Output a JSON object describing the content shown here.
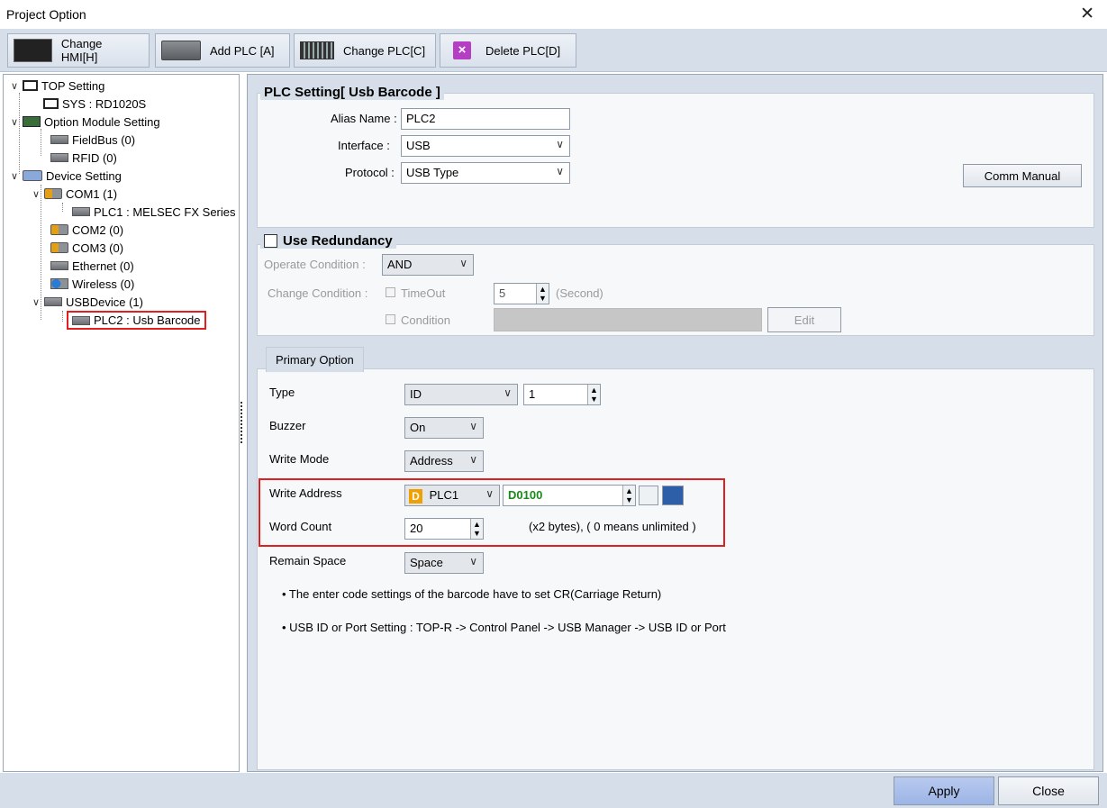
{
  "window": {
    "title": "Project Option",
    "close_glyph": "✕"
  },
  "toolbar": {
    "change_hmi": "Change HMI[H]",
    "add_plc": "Add PLC [A]",
    "change_plc": "Change PLC[C]",
    "delete_plc": "Delete PLC[D]"
  },
  "tree": {
    "top_setting": "TOP Setting",
    "sys": "SYS : RD1020S",
    "option_module": "Option Module Setting",
    "fieldbus": "FieldBus (0)",
    "rfid": "RFID (0)",
    "device_setting": "Device Setting",
    "com1": "COM1 (1)",
    "plc1": "PLC1 : MELSEC FX Series",
    "com2": "COM2 (0)",
    "com3": "COM3 (0)",
    "ethernet": "Ethernet (0)",
    "wireless": "Wireless (0)",
    "usbdevice": "USBDevice (1)",
    "plc2": "PLC2 : Usb Barcode"
  },
  "plc_setting": {
    "title": "PLC Setting[ Usb Barcode ]",
    "alias_label": "Alias Name :",
    "alias_value": "PLC2",
    "interface_label": "Interface :",
    "interface_value": "USB",
    "protocol_label": "Protocol :",
    "protocol_value": "USB Type",
    "comm_manual": "Comm Manual"
  },
  "redundancy": {
    "title": "Use Redundancy",
    "checked": false,
    "operate_label": "Operate Condition :",
    "operate_value": "AND",
    "change_label": "Change Condition :",
    "timeout_label": "TimeOut",
    "timeout_value": "5",
    "second_label": "(Second)",
    "condition_label": "Condition",
    "edit_button": "Edit"
  },
  "primary": {
    "tab": "Primary Option",
    "type_label": "Type",
    "type_value": "ID",
    "type_num": "1",
    "buzzer_label": "Buzzer",
    "buzzer_value": "On",
    "write_mode_label": "Write Mode",
    "write_mode_value": "Address",
    "write_address_label": "Write Address",
    "write_address_plc": "PLC1",
    "write_address_device_prefix": "D",
    "write_address_value": "D0100",
    "word_count_label": "Word Count",
    "word_count_value": "20",
    "word_count_note": "(x2 bytes), ( 0 means unlimited )",
    "remain_label": "Remain Space",
    "remain_value": "Space",
    "note1": "• The enter code settings of the barcode have to set CR(Carriage Return)",
    "note2": "• USB ID or Port Setting : TOP-R -> Control Panel -> USB Manager -> USB ID or Port"
  },
  "footer": {
    "apply": "Apply",
    "close": "Close"
  },
  "colors": {
    "accent_red": "#e02020",
    "panel": "#d6dee9",
    "address_green": "#1a8a1a",
    "device_orange": "#f0a000"
  }
}
